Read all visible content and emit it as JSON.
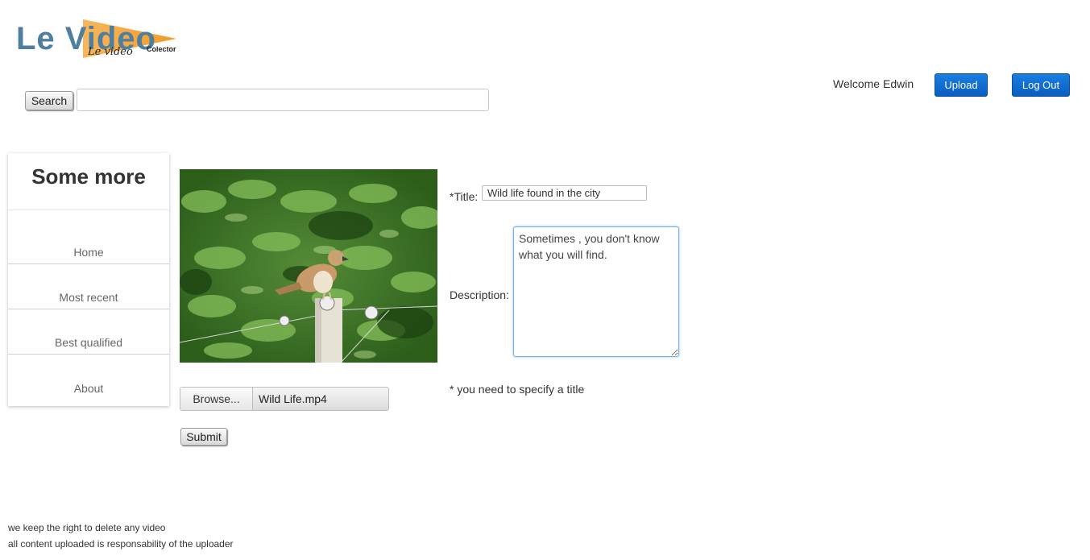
{
  "logo": {
    "main_text": "Le Video",
    "script_text": "Le video",
    "small_text": "Colector"
  },
  "search": {
    "button_label": "Search",
    "value": "",
    "placeholder": ""
  },
  "header": {
    "welcome_text": "Welcome Edwin",
    "upload_label": "Upload",
    "logout_label": "Log Out"
  },
  "sidebar": {
    "title": "Some more",
    "items": [
      {
        "label": "Home"
      },
      {
        "label": "Most recent"
      },
      {
        "label": "Best qualified"
      },
      {
        "label": "About"
      }
    ]
  },
  "upload": {
    "browse_label": "Browse...",
    "file_name": "Wild Life.mp4",
    "submit_label": "Submit"
  },
  "form": {
    "title_label": "*Title:",
    "title_value": "Wild life found in the city",
    "description_label": "Description:",
    "description_value": "Sometimes , you don't know what you will find.",
    "title_note": "* you need to specify a title"
  },
  "footer": {
    "line1": "we keep the right to delete any video",
    "line2": "all content uploaded is responsability of the uploader"
  },
  "colors": {
    "accent_blue": "#0a5dc1",
    "logo_blue": "#4f7f9e",
    "logo_orange": "#f4a640"
  }
}
